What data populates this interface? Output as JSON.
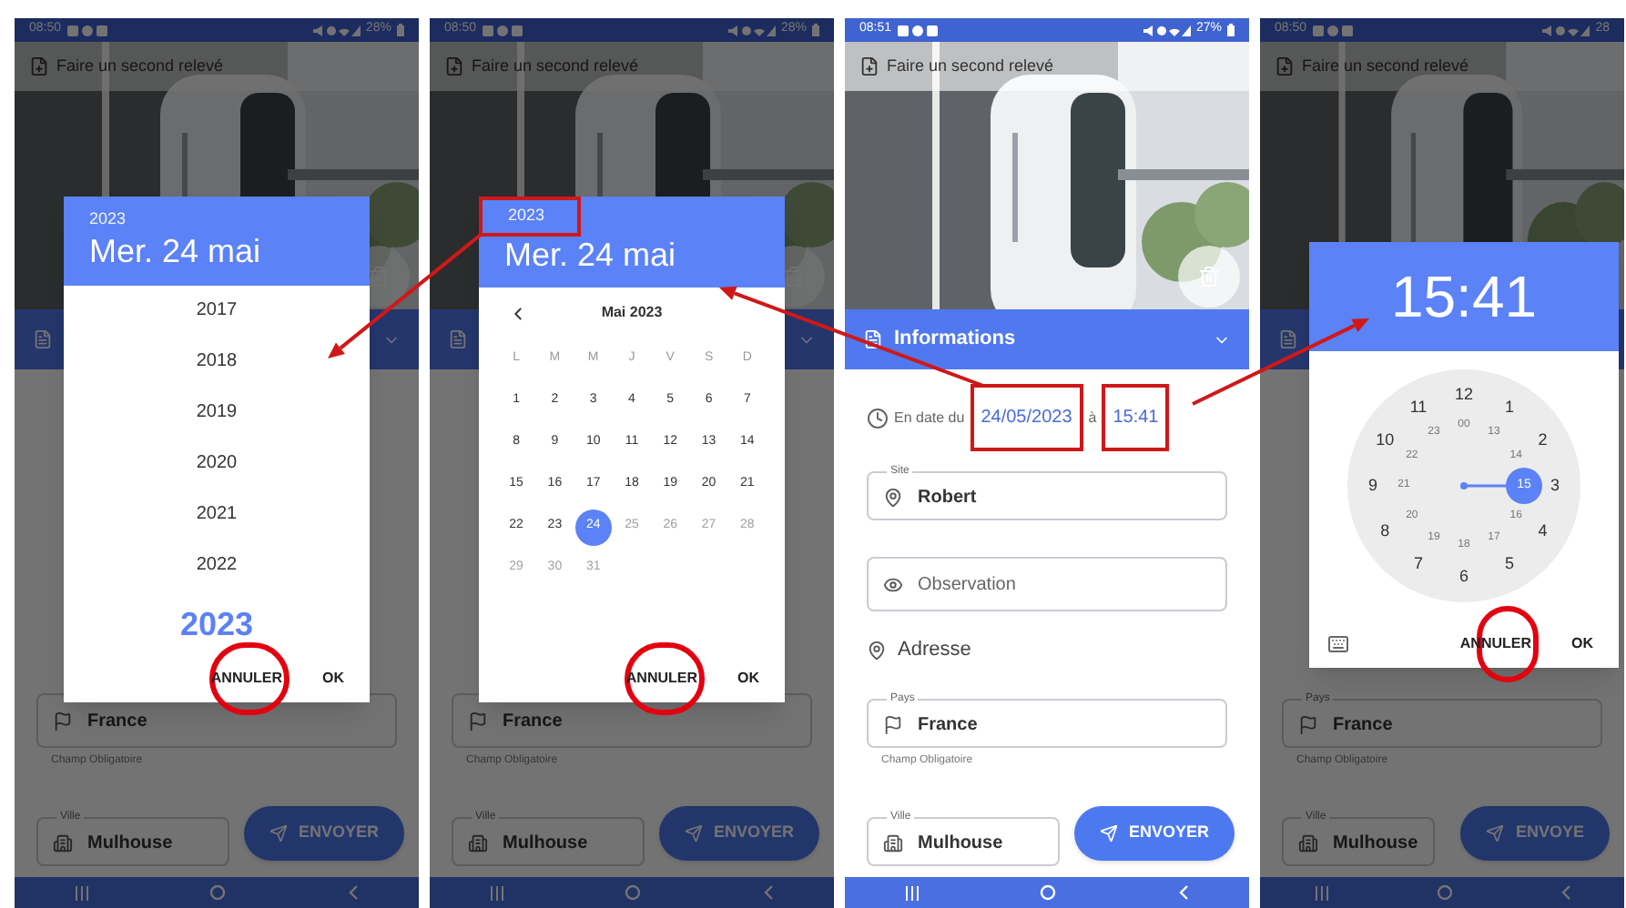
{
  "phones": [
    {
      "status": {
        "time": "08:50",
        "battery": "28%"
      },
      "title": "Faire un second relevé",
      "photo_delete": true,
      "form": [
        {
          "kind": "country",
          "value": "France"
        },
        {
          "kind": "hint",
          "text": "Champ Obligatoire"
        },
        {
          "kind": "city",
          "label": "Ville",
          "value": "Mulhouse"
        }
      ],
      "send_button": "ENVOYER",
      "dialog": {
        "kind": "year_list",
        "year": "2023",
        "date": "Mer. 24 mai",
        "highlight_cancel": true,
        "years": [
          {
            "label": "2017",
            "selected": false
          },
          {
            "label": "2018",
            "selected": false
          },
          {
            "label": "2019",
            "selected": false
          },
          {
            "label": "2020",
            "selected": false
          },
          {
            "label": "2021",
            "selected": false
          },
          {
            "label": "2022",
            "selected": false
          },
          {
            "label": "2023",
            "selected": true
          }
        ],
        "buttons": [
          "ANNULER",
          "OK"
        ]
      }
    },
    {
      "status": {
        "time": "08:50",
        "battery": "28%"
      },
      "title": "Faire un second relevé",
      "photo_delete": true,
      "form": [
        {
          "kind": "country",
          "value": "France"
        },
        {
          "kind": "hint",
          "text": "Champ Obligatoire"
        },
        {
          "kind": "city",
          "label": "Ville",
          "value": "Mulhouse"
        }
      ],
      "send_button": "ENVOYER",
      "dialog": {
        "kind": "calendar",
        "year": "2023",
        "highlight_year": true,
        "date": "Mer. 24 mai",
        "month": "Mai 2023",
        "highlight_cancel": true,
        "weekdays": [
          "L",
          "M",
          "M",
          "J",
          "V",
          "S",
          "D"
        ],
        "days": [
          {
            "label": "1",
            "selected": false,
            "disabled": false
          },
          {
            "label": "2",
            "selected": false,
            "disabled": false
          },
          {
            "label": "3",
            "selected": false,
            "disabled": false
          },
          {
            "label": "4",
            "selected": false,
            "disabled": false
          },
          {
            "label": "5",
            "selected": false,
            "disabled": false
          },
          {
            "label": "6",
            "selected": false,
            "disabled": false
          },
          {
            "label": "7",
            "selected": false,
            "disabled": false
          },
          {
            "label": "8",
            "selected": false,
            "disabled": false
          },
          {
            "label": "9",
            "selected": false,
            "disabled": false
          },
          {
            "label": "10",
            "selected": false,
            "disabled": false
          },
          {
            "label": "11",
            "selected": false,
            "disabled": false
          },
          {
            "label": "12",
            "selected": false,
            "disabled": false
          },
          {
            "label": "13",
            "selected": false,
            "disabled": false
          },
          {
            "label": "14",
            "selected": false,
            "disabled": false
          },
          {
            "label": "15",
            "selected": false,
            "disabled": false
          },
          {
            "label": "16",
            "selected": false,
            "disabled": false
          },
          {
            "label": "17",
            "selected": false,
            "disabled": false
          },
          {
            "label": "18",
            "selected": false,
            "disabled": false
          },
          {
            "label": "19",
            "selected": false,
            "disabled": false
          },
          {
            "label": "20",
            "selected": false,
            "disabled": false
          },
          {
            "label": "21",
            "selected": false,
            "disabled": false
          },
          {
            "label": "22",
            "selected": false,
            "disabled": false
          },
          {
            "label": "23",
            "selected": false,
            "disabled": false
          },
          {
            "label": "24",
            "selected": true,
            "disabled": false
          },
          {
            "label": "25",
            "selected": false,
            "disabled": true
          },
          {
            "label": "26",
            "selected": false,
            "disabled": true
          },
          {
            "label": "27",
            "selected": false,
            "disabled": true
          },
          {
            "label": "28",
            "selected": false,
            "disabled": true
          },
          {
            "label": "29",
            "selected": false,
            "disabled": true
          },
          {
            "label": "30",
            "selected": false,
            "disabled": true
          },
          {
            "label": "31",
            "selected": false,
            "disabled": true
          }
        ],
        "buttons": [
          "ANNULER",
          "OK"
        ]
      }
    },
    {
      "status": {
        "time": "08:51",
        "battery": "27%"
      },
      "title": "Faire un second relevé",
      "photo_delete": true,
      "info_title": "Informations",
      "form": [
        {
          "kind": "date_row",
          "prefix": "En date du",
          "date": "24/05/2023",
          "joiner": "à",
          "time": "15:41",
          "highlight": true
        },
        {
          "kind": "site",
          "label": "Site",
          "value": "Robert"
        },
        {
          "kind": "observation",
          "placeholder": "Observation"
        },
        {
          "kind": "section",
          "text": "Adresse"
        },
        {
          "kind": "country",
          "label": "Pays",
          "value": "France"
        },
        {
          "kind": "hint",
          "text": "Champ Obligatoire"
        },
        {
          "kind": "city",
          "label": "Ville",
          "value": "Mulhouse"
        }
      ],
      "send_button": "ENVOYER"
    },
    {
      "status": {
        "time": "08:50",
        "battery": "28"
      },
      "title": "Faire un second relevé",
      "form": [
        {
          "kind": "country",
          "label": "Pays",
          "value": "France"
        },
        {
          "kind": "hint",
          "text": "Champ Obligatoire"
        },
        {
          "kind": "city",
          "label": "Ville",
          "value": "Mulhouse"
        }
      ],
      "send_button": "ENVOYE",
      "dialog": {
        "kind": "clock",
        "time": "15:41",
        "highlight_cancel": true,
        "outer": [
          "12",
          "1",
          "2",
          "3",
          "4",
          "5",
          "6",
          "7",
          "8",
          "9",
          "10",
          "11"
        ],
        "inner": [
          {
            "label": "00",
            "selected": false
          },
          {
            "label": "13",
            "selected": false
          },
          {
            "label": "14",
            "selected": false
          },
          {
            "label": "15",
            "selected": true
          },
          {
            "label": "16",
            "selected": false
          },
          {
            "label": "17",
            "selected": false
          },
          {
            "label": "18",
            "selected": false
          },
          {
            "label": "19",
            "selected": false
          },
          {
            "label": "20",
            "selected": false
          },
          {
            "label": "21",
            "selected": false
          },
          {
            "label": "22",
            "selected": false
          },
          {
            "label": "23",
            "selected": false
          }
        ],
        "buttons": [
          "ANNULER",
          "OK"
        ]
      }
    }
  ]
}
